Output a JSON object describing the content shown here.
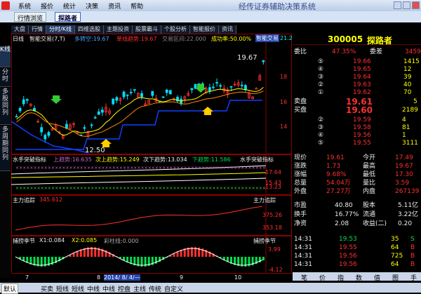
{
  "titlebar": {
    "menus": [
      "系统",
      "报价",
      "统计",
      "决策",
      "资讯",
      "帮助"
    ],
    "title": "经传证券辅助决策系统"
  },
  "tabs": [
    "行情浏览",
    "探路者"
  ],
  "nav": [
    "大盘",
    "行情",
    "分时/K线",
    "四维选股",
    "主题投资",
    "股票霸斗",
    "个股分析",
    "智能报价",
    "资讯"
  ],
  "vtabs": [
    "K线",
    "分时",
    "多股同列",
    "多周期同列"
  ],
  "chart": {
    "period": "日线",
    "indicator": "智能交易(7,T)",
    "ind_values": [
      "多转空:19.67",
      "单线趋势:19.67",
      "交易区间:22.000",
      "成功率:50.00%"
    ],
    "ind_btn": "智能交易",
    "price_label": "21.27",
    "peak_label": "19.67",
    "low_label": "12.50",
    "yticks_main": [
      "20",
      "18",
      "16",
      "14"
    ],
    "panel2_title": "水手突破指标",
    "panel2_vals": [
      "上趋势:16.635",
      "次上趋势:15.249",
      "次下趋势:13.034",
      "下趋势:11.586"
    ],
    "panel2_name": "水手突破指标",
    "panel2_ticks": [
      "17.64",
      "15.43",
      "13.23"
    ],
    "panel3_title": "主力追踪",
    "panel3_val": "345.612",
    "panel3_name": "主力追踪",
    "panel3_ticks": [
      "375.26",
      "353.18"
    ],
    "panel4_title": "捕捞季节",
    "panel4_vals": [
      "X1:0.084",
      "X2:0.085",
      "彩柱线:0.000"
    ],
    "panel4_name": "捕捞季节",
    "panel4_ticks": [
      "3.99",
      "-4.12"
    ],
    "xaxis": [
      "7",
      "8",
      "2014/ 8/ 4/—",
      "9",
      "10"
    ]
  },
  "quote": {
    "code": "300005",
    "name": "探路者",
    "weibi": {
      "label": "委比",
      "val": "47.35%",
      "label2": "委差",
      "val2": "3459"
    },
    "asks": [
      {
        "lvl": "⑤",
        "price": "19.66",
        "vol": "1415"
      },
      {
        "lvl": "④",
        "price": "19.65",
        "vol": "12"
      },
      {
        "lvl": "③",
        "price": "19.64",
        "vol": "39"
      },
      {
        "lvl": "②",
        "price": "19.63",
        "vol": "40"
      },
      {
        "lvl": "①",
        "price": "19.62",
        "vol": "70"
      }
    ],
    "sell": {
      "label": "卖盘",
      "price": "19.61",
      "vol": "5"
    },
    "buy": {
      "label": "买盘",
      "price": "19.60",
      "vol": "2189"
    },
    "bids": [
      {
        "lvl": "②",
        "price": "19.59",
        "vol": "4"
      },
      {
        "lvl": "③",
        "price": "19.58",
        "vol": "81"
      },
      {
        "lvl": "④",
        "price": "19.56",
        "vol": "1"
      },
      {
        "lvl": "⑤",
        "price": "19.55",
        "vol": "3111"
      }
    ],
    "stats": [
      {
        "a": "现价",
        "b": "19.61",
        "c": "今开",
        "d": "17.49"
      },
      {
        "a": "涨跌",
        "b": "1.73",
        "c": "最高",
        "d": "19.67"
      },
      {
        "a": "涨幅",
        "b": "9.68%",
        "c": "最低",
        "d": "17.30"
      },
      {
        "a": "总量",
        "b": "54.04万",
        "c": "量比",
        "d": "3.59"
      },
      {
        "a": "外盘",
        "b": "27.27万",
        "c": "内盘",
        "d": "267139"
      }
    ],
    "stats2": [
      {
        "a": "市盈",
        "b": "40.80",
        "c": "股本",
        "d": "5.11亿"
      },
      {
        "a": "换手",
        "b": "16.77%",
        "c": "流通",
        "d": "3.22亿"
      },
      {
        "a": "净资",
        "b": "2.08",
        "c": "收益(二)",
        "d": "0.20"
      }
    ],
    "ticks": [
      {
        "t": "14:31",
        "p": "19.53",
        "v": "35",
        "f": "S"
      },
      {
        "t": "14:31",
        "p": "19.55",
        "v": "64",
        "f": "B"
      },
      {
        "t": "14:31",
        "p": "19.56",
        "v": "725",
        "f": "B"
      },
      {
        "t": "14:31",
        "p": "19.56",
        "v": "64",
        "f": "B"
      }
    ],
    "tabs": [
      "笔",
      "价",
      "指",
      "数",
      "值",
      "图",
      "手"
    ]
  },
  "bottom": [
    "默认",
    "买卖",
    "短线",
    "短线",
    "中线",
    "中线",
    "控盘",
    "主线",
    "传统",
    "自定义"
  ]
}
